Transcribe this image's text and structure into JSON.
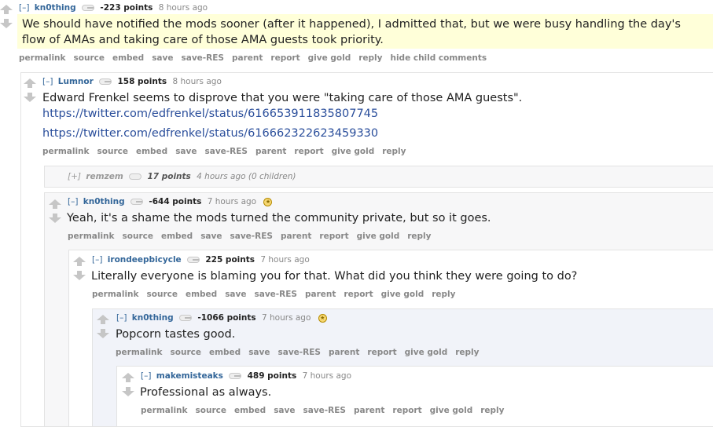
{
  "arrows": {
    "up_icon": "upvote-arrow",
    "down_icon": "downvote-arrow"
  },
  "comments": [
    {
      "expand": "[–]",
      "author": "kn0thing",
      "score": "-223 points",
      "time": "8 hours ago",
      "text": "We should have notified the mods sooner (after it happened), I admitted that, but we were busy handling the day's flow of AMAs and taking care of those AMA guests took priority.",
      "actions": [
        "permalink",
        "source",
        "embed",
        "save",
        "save-RES",
        "parent",
        "report",
        "give gold",
        "reply",
        "hide child comments"
      ]
    },
    {
      "expand": "[–]",
      "author": "Lumnor",
      "score": "158 points",
      "time": "8 hours ago",
      "text": "Edward Frenkel seems to disprove that you were \"taking care of those AMA guests\".",
      "links": [
        "https://twitter.com/edfrenkel/status/616653911835807745",
        "https://twitter.com/edfrenkel/status/616662322623459330"
      ],
      "actions": [
        "permalink",
        "source",
        "embed",
        "save",
        "save-RES",
        "parent",
        "report",
        "give gold",
        "reply"
      ]
    },
    {
      "collapsed": true,
      "expand": "[+]",
      "author": "remzem",
      "score": "17 points",
      "time": "4 hours ago",
      "children": "(0 children)"
    },
    {
      "expand": "[–]",
      "author": "kn0thing",
      "score": "-644 points",
      "time": "7 hours ago",
      "gilded": true,
      "text": "Yeah, it's a shame the mods turned the community private, but so it goes.",
      "actions": [
        "permalink",
        "source",
        "embed",
        "save",
        "save-RES",
        "parent",
        "report",
        "give gold",
        "reply"
      ]
    },
    {
      "expand": "[–]",
      "author": "irondeepbicycle",
      "score": "225 points",
      "time": "7 hours ago",
      "text": "Literally everyone is blaming you for that. What did you think they were going to do?",
      "actions": [
        "permalink",
        "source",
        "embed",
        "save",
        "save-RES",
        "parent",
        "report",
        "give gold",
        "reply"
      ]
    },
    {
      "expand": "[–]",
      "author": "kn0thing",
      "score": "-1066 points",
      "time": "7 hours ago",
      "gilded": true,
      "text": "Popcorn tastes good.",
      "actions": [
        "permalink",
        "source",
        "embed",
        "save",
        "save-RES",
        "parent",
        "report",
        "give gold",
        "reply"
      ]
    },
    {
      "expand": "[–]",
      "author": "makemisteaks",
      "score": "489 points",
      "time": "7 hours ago",
      "text": "Professional as always.",
      "actions": [
        "permalink",
        "source",
        "embed",
        "save",
        "save-RES",
        "parent",
        "report",
        "give gold",
        "reply"
      ]
    }
  ],
  "colors": {
    "author": "#336699",
    "link": "#2a4e9b",
    "highlight": "#ffffd9",
    "action": "#888888"
  }
}
